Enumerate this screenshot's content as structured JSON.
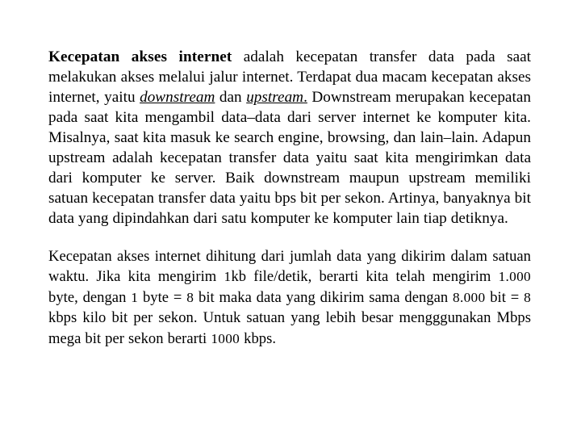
{
  "document": {
    "background_color": "#ffffff",
    "text_color": "#000000",
    "paragraphs": [
      {
        "id": "paragraph-1",
        "lead_bold": "Kecepatan akses internet",
        "segment_1": " adalah kecepatan transfer data pada saat melakukan akses melalui jalur internet. Terdapat dua macam kecepatan akses internet, yaitu ",
        "term_1": "downstream",
        "segment_2": " dan ",
        "term_2": "upstream",
        "term_2_tail": ".",
        "segment_3": " Downstream merupakan kecepatan pada saat kita mengambil data–data dari server internet ke komputer kita. Misalnya, saat kita masuk ke search engine, browsing, dan lain–lain. Adapun upstream adalah kecepatan transfer data yaitu saat kita mengirimkan data dari komputer ke server. Baik downstream maupun upstream memiliki satuan kecepatan transfer data yaitu bps bit per sekon. Artinya, banyaknya bit data yang dipindahkan dari satu komputer ke komputer lain tiap detiknya.",
        "full_text": "Kecepatan akses internet adalah kecepatan transfer data pada saat melakukan akses melalui jalur internet. Terdapat dua macam kecepatan akses internet, yaitu downstream dan upstream. Downstream merupakan kecepatan pada saat kita mengambil data–data dari server internet ke komputer kita. Misalnya, saat kita masuk ke search engine, browsing, dan lain–lain. Adapun upstream adalah kecepatan transfer data yaitu saat kita mengirimkan data dari komputer ke server. Baik downstream maupun upstream memiliki satuan kecepatan transfer data yaitu bps bit per sekon. Artinya, banyaknya bit data yang dipindahkan dari satu komputer ke komputer lain tiap detiknya."
      },
      {
        "id": "paragraph-2",
        "s1": "Kecepatan akses internet dihitung dari jumlah data yang dikirim dalam satuan waktu. Jika kita mengirim ",
        "n1": "1",
        "s2": "kb file/detik, berarti kita telah mengirim ",
        "n2": "1.000",
        "s3": " byte, dengan ",
        "n3": "1",
        "s4": " byte = ",
        "n4": "8",
        "s5": " bit maka data yang dikirim sama dengan ",
        "n5": "8.000",
        "s6": " bit = ",
        "n6": "8",
        "s7": " kbps kilo bit per sekon. Untuk satuan yang lebih besar mengggunakan Mbps mega bit per sekon berarti ",
        "n7": "1000",
        "s8": " kbps.",
        "full_text": "Kecepatan akses internet dihitung dari jumlah data yang dikirim dalam satuan waktu. Jika kita mengirim 1kb file/detik, berarti kita telah mengirim 1.000 byte, dengan 1 byte = 8 bit maka data yang dikirim sama dengan 8.000 bit = 8 kbps kilo bit per sekon. Untuk satuan yang lebih besar mengggunakan Mbps mega bit per sekon berarti 1000 kbps."
      }
    ]
  }
}
